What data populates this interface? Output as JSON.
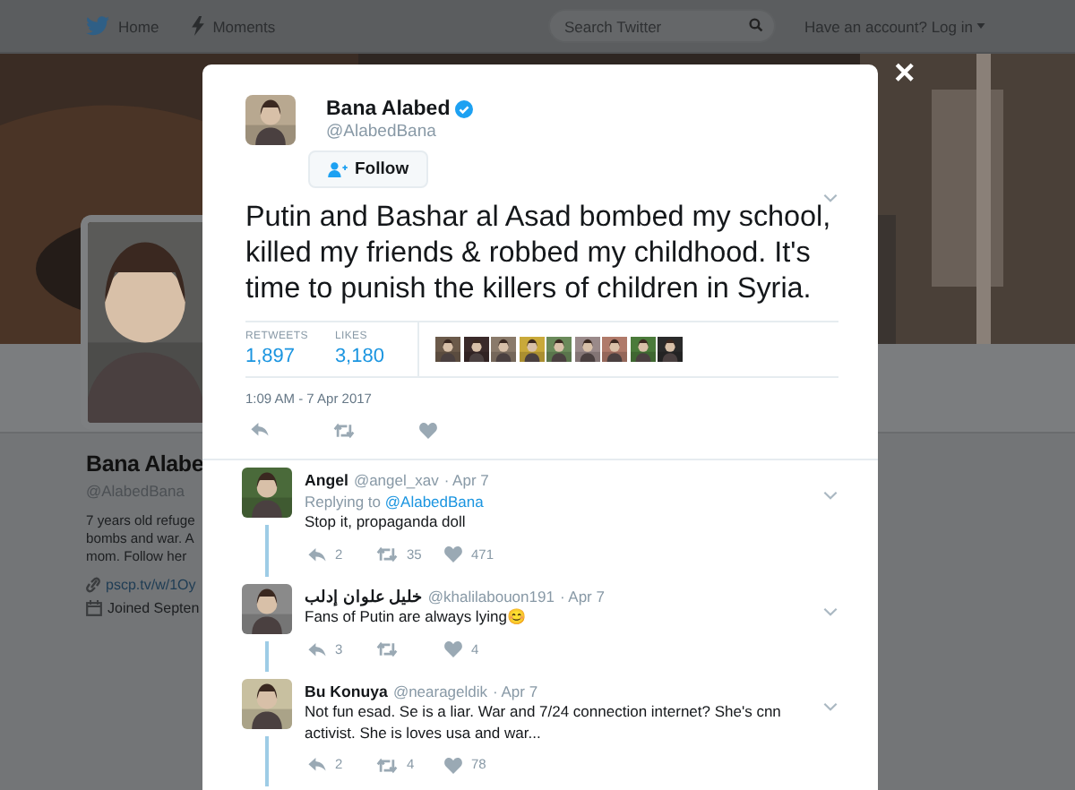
{
  "nav": {
    "items": [
      {
        "label": "Home",
        "kind": "bird"
      },
      {
        "label": "Moments",
        "kind": "bolt"
      }
    ],
    "search": {
      "placeholder": "Search Twitter"
    },
    "login": "Have an account? Log in"
  },
  "profile": {
    "name": "Bana Alabe",
    "handle": "@AlabedBana",
    "bio": [
      "7 years old refuge",
      "bombs and war. A",
      "mom. Follow her"
    ],
    "link": "pscp.tv/w/1Oy",
    "joined": "Joined Septen"
  },
  "modal": {
    "close": "×",
    "tweet": {
      "name": "Bana Alabed",
      "verified": true,
      "handle": "@AlabedBana",
      "follow": "Follow",
      "text": "Putin and Bashar al Asad bombed my school, killed my friends & robbed my childhood. It's time to punish the killers of children in Syria.",
      "stats": [
        {
          "label": "RETWEETS",
          "value": "1,897"
        },
        {
          "label": "LIKES",
          "value": "3,180"
        }
      ],
      "timestamp": "1:09 AM - 7 Apr 2017"
    },
    "replies": [
      {
        "name": "Angel",
        "handle": "@angel_xav",
        "date": "· Apr 7",
        "replying_prefix": "Replying to",
        "replying_handle": "@AlabedBana",
        "text": "Stop it, propaganda doll",
        "replies": "2",
        "retweets": "35",
        "likes": "471"
      },
      {
        "name": "خليل علوان إدلب",
        "handle": "@khalilabouon191",
        "date": "· Apr 7",
        "text": "Fans of Putin are always lying😊",
        "replies": "3",
        "likes": "4"
      },
      {
        "name": "Bu Konuya",
        "handle": "@nearageldik",
        "date": "· Apr 7",
        "text": "Not fun esad. Se is a liar. War and 7/24 connection internet? She's cnn activist. She is loves usa and war...",
        "replies": "2",
        "retweets": "4",
        "likes": "78"
      }
    ]
  }
}
